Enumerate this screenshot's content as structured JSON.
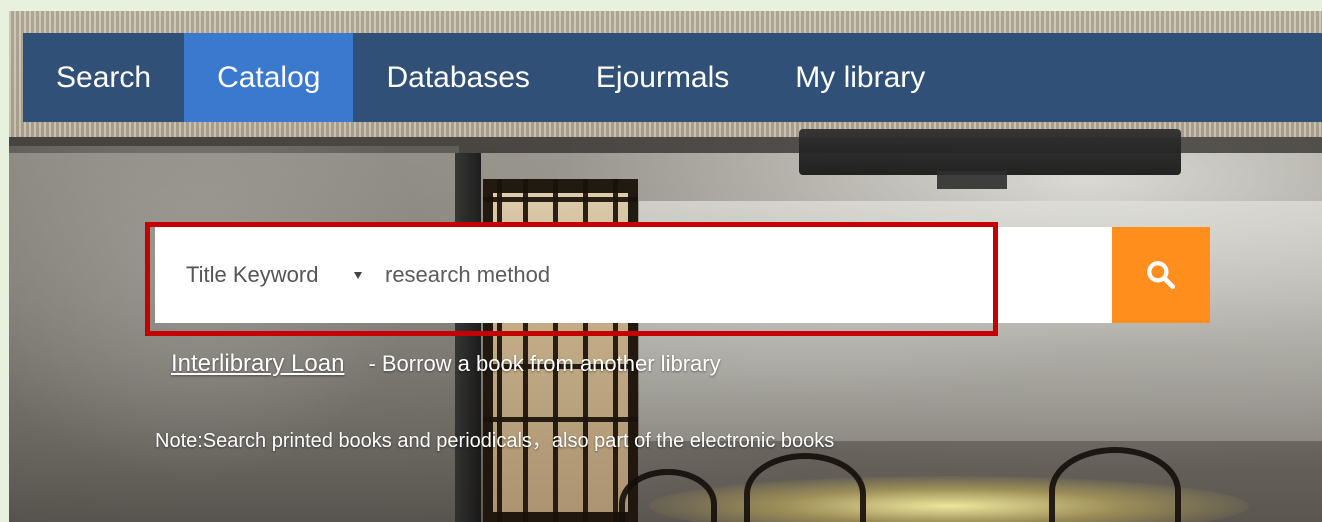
{
  "nav": {
    "tabs": [
      {
        "label": "Search"
      },
      {
        "label": "Catalog",
        "active": true
      },
      {
        "label": "Databases"
      },
      {
        "label": "Ejourmals"
      },
      {
        "label": "My library"
      }
    ]
  },
  "search": {
    "field_type": "Title Keyword",
    "query": "research method",
    "button_icon": "search-icon"
  },
  "links": {
    "interlibrary_loan_label": "Interlibrary Loan",
    "interlibrary_loan_desc": "- Borrow a book from another library"
  },
  "note": "Note:Search printed books and periodicals，also part of the electronic books",
  "colors": {
    "nav_bg": "#315077",
    "active_tab": "#3b79ce",
    "search_button": "#ff8e1d",
    "highlight_border": "#c40000",
    "outer_bg": "#e7f1de"
  }
}
